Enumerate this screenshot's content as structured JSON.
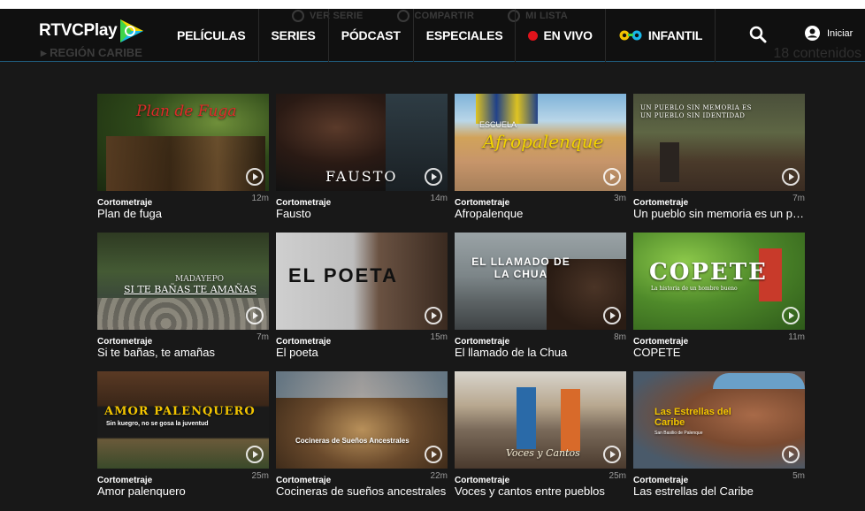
{
  "brand": {
    "name": "RTVCPlay"
  },
  "ghost_actions": [
    "Ver serie",
    "Compartir",
    "Mi lista"
  ],
  "ghost_region": "▸ REGIÓN CARIBE",
  "ghost_count": "18 contenidos",
  "nav": {
    "items": [
      {
        "label": "PELÍCULAS"
      },
      {
        "label": "SERIES"
      },
      {
        "label": "PÓDCAST"
      },
      {
        "label": "ESPECIALES"
      },
      {
        "label": "EN VIVO"
      },
      {
        "label": "INFANTIL"
      }
    ],
    "login_label": "Iniciar"
  },
  "accent": {
    "live": "#e0131b",
    "logo_green": "#3fd44a",
    "logo_cyan": "#18b7e8",
    "logo_yellow": "#f2d400"
  },
  "cards": [
    {
      "category": "Cortometraje",
      "duration": "12m",
      "title": "Plan de fuga",
      "thumb_text": "Plan de Fuga"
    },
    {
      "category": "Cortometraje",
      "duration": "14m",
      "title": "Fausto",
      "thumb_text": "FAUSTO"
    },
    {
      "category": "Cortometraje",
      "duration": "3m",
      "title": "Afropalenque",
      "thumb_text": "Afropalenque",
      "thumb_subtext": "ESCUELA"
    },
    {
      "category": "Cortometraje",
      "duration": "7m",
      "title": "Un pueblo sin memoria es un pueblo sin identidad",
      "thumb_text": "UN PUEBLO SIN MEMORIA ES UN PUEBLO SIN IDENTIDAD"
    },
    {
      "category": "Cortometraje",
      "duration": "7m",
      "title": "Si te bañas, te amañas",
      "thumb_text": "SI TE BAÑAS TE AMAÑAS",
      "thumb_subtext": "MADAYEPO"
    },
    {
      "category": "Cortometraje",
      "duration": "15m",
      "title": "El poeta",
      "thumb_text": "EL POETA"
    },
    {
      "category": "Cortometraje",
      "duration": "8m",
      "title": "El llamado de la Chua",
      "thumb_text": "EL LLAMADO DE LA CHUA"
    },
    {
      "category": "Cortometraje",
      "duration": "11m",
      "title": "COPETE",
      "thumb_text": "COPETE",
      "thumb_subtext": "La historia de un hombre bueno"
    },
    {
      "category": "Cortometraje",
      "duration": "25m",
      "title": "Amor palenquero",
      "thumb_text": "AMOR PALENQUERO",
      "thumb_subtext": "Sin kuegro, no se gosa la juventud"
    },
    {
      "category": "Cortometraje",
      "duration": "22m",
      "title": "Cocineras de sueños ancestrales",
      "thumb_text": "Cocineras de Sueños Ancestrales"
    },
    {
      "category": "Cortometraje",
      "duration": "25m",
      "title": "Voces y cantos entre pueblos",
      "thumb_text": "Voces y Cantos"
    },
    {
      "category": "Cortometraje",
      "duration": "5m",
      "title": "Las estrellas del Caribe",
      "thumb_text": "Las Estrellas del Caribe",
      "thumb_subtext": "San Basilio de Palenque"
    }
  ]
}
